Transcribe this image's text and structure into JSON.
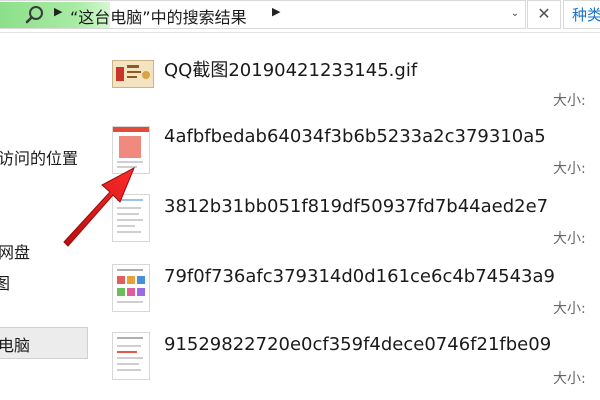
{
  "address_bar": {
    "breadcrumb": "“这台电脑”中的搜索结果",
    "search_box_text": "种类"
  },
  "sidebar": {
    "items": [
      {
        "label": "访问的位置"
      },
      {
        "label": "网盘"
      },
      {
        "label": "图"
      },
      {
        "label": "电脑"
      }
    ]
  },
  "files": [
    {
      "name": "QQ截图20190421233145.gif",
      "size_label": "大小:"
    },
    {
      "name": "4afbfbedab64034f3b6b5233a2c379310a5",
      "size_label": "大小:"
    },
    {
      "name": "3812b31bb051f819df50937fd7b44aed2e7",
      "size_label": "大小:"
    },
    {
      "name": "79f0f736afc379314d0d161ce6c4b74543a9",
      "size_label": "大小:"
    },
    {
      "name": "91529822720e0cf359f4dece0746f21fbe09",
      "size_label": "大小:"
    }
  ],
  "colors": {
    "search_highlight": "#8ce08a",
    "arrow": "#e21d1d",
    "link_blue": "#1a73c8"
  }
}
